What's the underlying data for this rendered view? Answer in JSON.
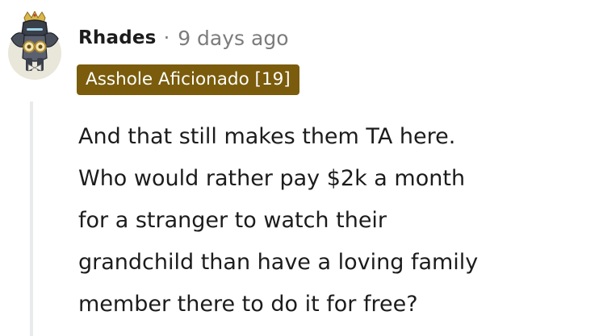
{
  "comment": {
    "author": "Rhades",
    "separator": "·",
    "timestamp": "9 days ago",
    "flair": "Asshole Aficionado [19]",
    "avatar_icon": "robot-knight-avatar-icon",
    "body_lines": [
      "And that still makes them TA here.",
      "Who would rather pay $2k a month",
      "for a stranger to watch their",
      "grandchild than have a loving family",
      "member there to do it for free?"
    ]
  },
  "colors": {
    "flair_background": "#7a5c0c",
    "flair_text": "#ffffff",
    "muted_text": "#7c7c7c",
    "thread_line": "#e9eaeb"
  }
}
